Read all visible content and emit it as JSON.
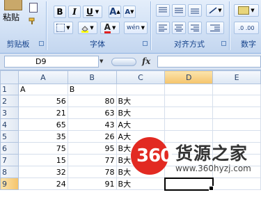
{
  "ribbon": {
    "paste_label": "粘贴",
    "groups": {
      "clipboard": "剪贴板",
      "font": "字体",
      "alignment": "对齐方式",
      "number": "数字"
    },
    "format_buttons": {
      "bold": "B",
      "italic": "I",
      "underline": "U",
      "font_color": "A"
    },
    "font_size_grow": "A",
    "font_size_shrink": "A",
    "phonetic": "wén"
  },
  "formula_bar": {
    "name_box": "D9",
    "fx": "fx",
    "formula": ""
  },
  "columns": [
    "A",
    "B",
    "C",
    "D",
    "E"
  ],
  "rows": [
    {
      "n": "1",
      "a": "A",
      "b": "B",
      "c": ""
    },
    {
      "n": "2",
      "a": "56",
      "b": "80",
      "c": "B大"
    },
    {
      "n": "3",
      "a": "21",
      "b": "63",
      "c": "B大"
    },
    {
      "n": "4",
      "a": "65",
      "b": "43",
      "c": "A大"
    },
    {
      "n": "5",
      "a": "35",
      "b": "26",
      "c": "A大"
    },
    {
      "n": "6",
      "a": "75",
      "b": "95",
      "c": "B大"
    },
    {
      "n": "7",
      "a": "15",
      "b": "77",
      "c": "B大"
    },
    {
      "n": "8",
      "a": "32",
      "b": "78",
      "c": "B大"
    },
    {
      "n": "9",
      "a": "24",
      "b": "91",
      "c": "B大"
    }
  ],
  "selected_cell": "D9",
  "watermark": {
    "logo": "360",
    "name": "货源之家",
    "url": "www.360hyzj.com"
  },
  "colors": {
    "accent_blue": "#15428b",
    "selection_header": "#f5c46b",
    "watermark_red": "#e22a22"
  }
}
